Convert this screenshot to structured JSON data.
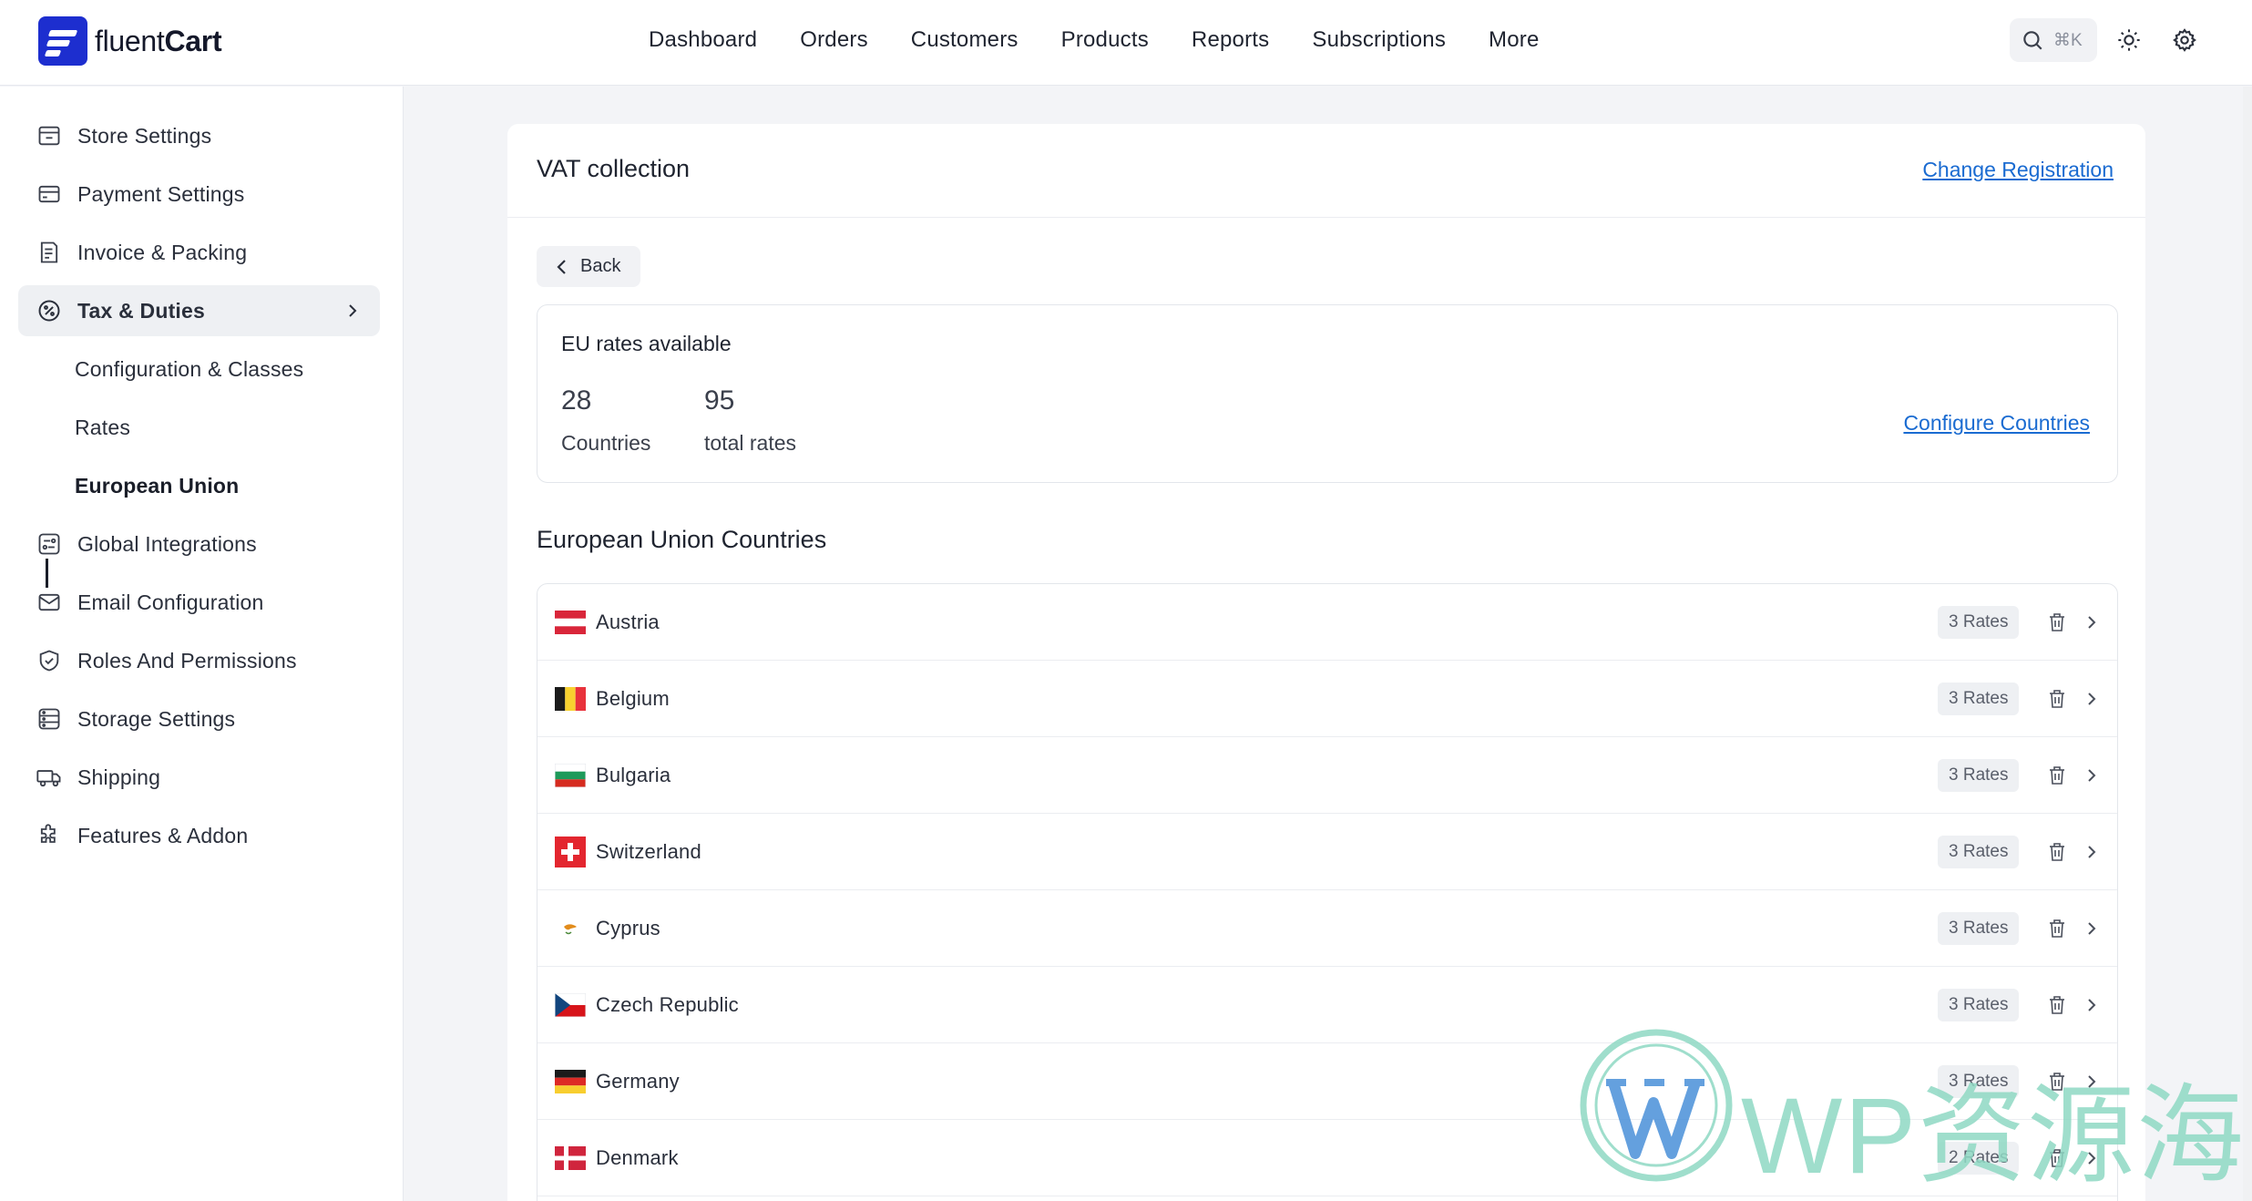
{
  "brand": {
    "name_light": "fluent",
    "name_bold": "Cart"
  },
  "nav": [
    "Dashboard",
    "Orders",
    "Customers",
    "Products",
    "Reports",
    "Subscriptions",
    "More"
  ],
  "search": {
    "shortcut": "⌘K"
  },
  "sidebar": {
    "items": [
      {
        "label": "Store Settings",
        "icon": "store-icon"
      },
      {
        "label": "Payment Settings",
        "icon": "card-icon"
      },
      {
        "label": "Invoice & Packing",
        "icon": "invoice-icon"
      },
      {
        "label": "Tax & Duties",
        "icon": "percent-icon"
      },
      {
        "label": "Global Integrations",
        "icon": "integrations-icon"
      },
      {
        "label": "Email Configuration",
        "icon": "mail-icon"
      },
      {
        "label": "Roles And Permissions",
        "icon": "shield-icon"
      },
      {
        "label": "Storage Settings",
        "icon": "storage-icon"
      },
      {
        "label": "Shipping",
        "icon": "truck-icon"
      },
      {
        "label": "Features & Addon",
        "icon": "puzzle-icon"
      }
    ],
    "sub_items": [
      "Configuration & Classes",
      "Rates",
      "European Union"
    ]
  },
  "card": {
    "title": "VAT collection",
    "change_registration": "Change Registration",
    "back": "Back"
  },
  "rates": {
    "title": "EU rates available",
    "countries_count": "28",
    "countries_label": "Countries",
    "total_count": "95",
    "total_label": "total rates",
    "configure": "Configure Countries"
  },
  "countries_section": {
    "title": "European Union Countries"
  },
  "countries": [
    {
      "name": "Austria",
      "rates": "3 Rates"
    },
    {
      "name": "Belgium",
      "rates": "3 Rates"
    },
    {
      "name": "Bulgaria",
      "rates": "3 Rates"
    },
    {
      "name": "Switzerland",
      "rates": "3 Rates"
    },
    {
      "name": "Cyprus",
      "rates": "3 Rates"
    },
    {
      "name": "Czech Republic",
      "rates": "3 Rates"
    },
    {
      "name": "Germany",
      "rates": "3 Rates"
    },
    {
      "name": "Denmark",
      "rates": "2 Rates"
    }
  ],
  "watermark": {
    "text": "WP资源海"
  },
  "colors": {
    "brand": "#1d2ecf",
    "link": "#1a6bd1",
    "active_bg": "#eef0f3",
    "watermark": "#8fd9c4"
  }
}
